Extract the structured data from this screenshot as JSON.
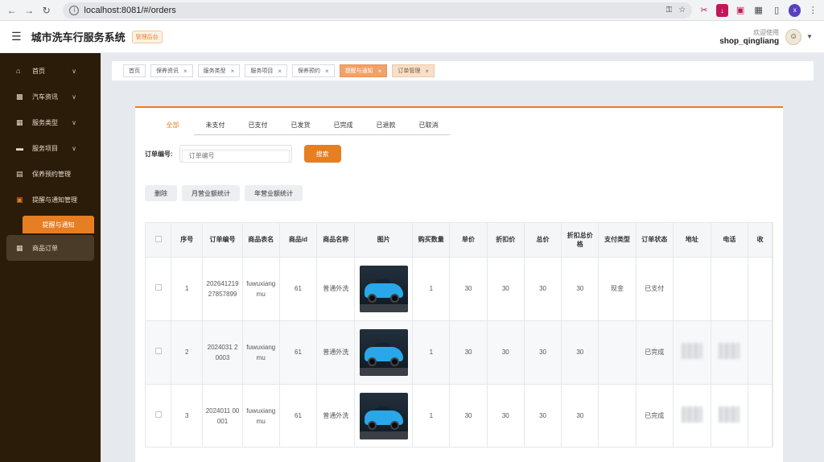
{
  "browser": {
    "url": "localhost:8081/#/orders"
  },
  "header": {
    "title": "城市洗车行服务系统",
    "badge": "管理后台",
    "welcome": "欢迎使用",
    "username": "shop_qingliang"
  },
  "sidebar": {
    "items": [
      {
        "label": "首页",
        "icon": "home-icon"
      },
      {
        "label": "汽车资讯",
        "icon": "wallet-icon"
      },
      {
        "label": "服务类型",
        "icon": "grid-icon"
      },
      {
        "label": "服务项目",
        "icon": "card-icon"
      },
      {
        "label": "保养预约管理",
        "icon": "calendar-icon"
      },
      {
        "label": "提醒与通知管理",
        "icon": "reminder-icon"
      }
    ],
    "sub_item": "提醒与通知",
    "orders_item": "商品订单"
  },
  "tabs": [
    {
      "label": "首页"
    },
    {
      "label": "保养资讯"
    },
    {
      "label": "服务类型"
    },
    {
      "label": "服务项目"
    },
    {
      "label": "保养预约"
    },
    {
      "label": "提醒与通知"
    },
    {
      "label": "订单管理"
    }
  ],
  "status_tabs": [
    "全部",
    "未支付",
    "已支付",
    "已发货",
    "已完成",
    "已退款",
    "已取消"
  ],
  "search": {
    "label": "订单编号:",
    "placeholder": "订单编号",
    "button": "搜索"
  },
  "actions": [
    "删除",
    "月营业额统计",
    "年营业额统计"
  ],
  "table": {
    "headers": [
      "序号",
      "订单编号",
      "商品表名",
      "商品id",
      "商品名称",
      "图片",
      "购买数量",
      "单价",
      "折扣价",
      "总价",
      "折扣总价格",
      "支付类型",
      "订单状态",
      "地址",
      "电话",
      "收"
    ],
    "rows": [
      {
        "index": "1",
        "order_no": "20264121927857899",
        "table_name": "fuwuxiangmu",
        "product_id": "61",
        "product_name": "普通外洗",
        "qty": "1",
        "price": "30",
        "discount_price": "30",
        "total": "30",
        "discount_total": "30",
        "pay_type": "现金",
        "status": "已支付"
      },
      {
        "index": "2",
        "order_no": "2024031 20003",
        "table_name": "fuwuxiangmu",
        "product_id": "61",
        "product_name": "普通外洗",
        "qty": "1",
        "price": "30",
        "discount_price": "30",
        "total": "30",
        "discount_total": "30",
        "pay_type": "",
        "status": "已完成"
      },
      {
        "index": "3",
        "order_no": "2024011 00001",
        "table_name": "fuwuxiangmu",
        "product_id": "61",
        "product_name": "普通外洗",
        "qty": "1",
        "price": "30",
        "discount_price": "30",
        "total": "30",
        "discount_total": "30",
        "pay_type": "",
        "status": "已完成"
      }
    ]
  },
  "colors": {
    "accent": "#e67e22",
    "sidebar": "#2b1c0a"
  }
}
